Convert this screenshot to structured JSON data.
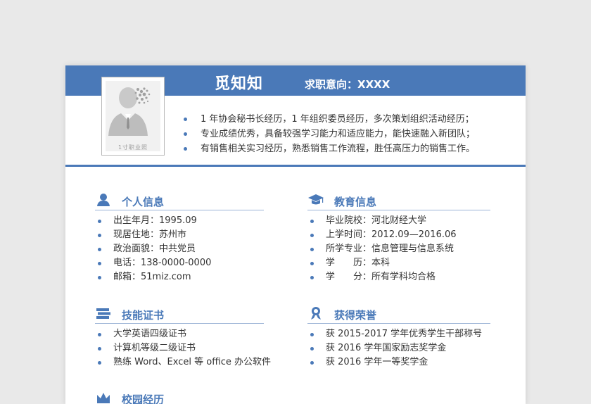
{
  "header": {
    "name": "觅知知",
    "intent": "求职意向：XXXX",
    "photo_caption": "1寸职业照"
  },
  "summary": [
    "1 年协会秘书长经历，1 年组织委员经历，多次策划组织活动经历；",
    "专业成绩优秀，具备较强学习能力和适应能力，能快速融入新团队；",
    "有销售相关实习经历，熟悉销售工作流程，胜任高压力的销售工作。"
  ],
  "personal": {
    "title": "个人信息",
    "icon": "person-icon",
    "items": [
      "出生年月：1995.09",
      "现居住地：苏州市",
      "政治面貌：中共党员",
      "电话：138-0000-0000",
      "邮箱：51miz.com"
    ]
  },
  "education": {
    "title": "教育信息",
    "icon": "graduation-cap-icon",
    "items": [
      "毕业院校：河北财经大学",
      "上学时间：2012.09—2016.06",
      "所学专业：信息管理与信息系统",
      "学　　历：本科",
      "学　　分：所有学科均合格"
    ]
  },
  "skills": {
    "title": "技能证书",
    "icon": "books-icon",
    "items": [
      "大学英语四级证书",
      "计算机等级二级证书",
      "熟练 Word、Excel 等 office 办公软件"
    ]
  },
  "honors": {
    "title": "获得荣誉",
    "icon": "medal-icon",
    "items": [
      "获 2015-2017 学年优秀学生干部称号",
      "获 2016 学年国家励志奖学金",
      "获 2016 学年一等奖学金"
    ]
  },
  "campus": {
    "title": "校园经历",
    "icon": "crown-icon"
  },
  "colors": {
    "accent": "#4a79b8",
    "text": "#333333"
  }
}
